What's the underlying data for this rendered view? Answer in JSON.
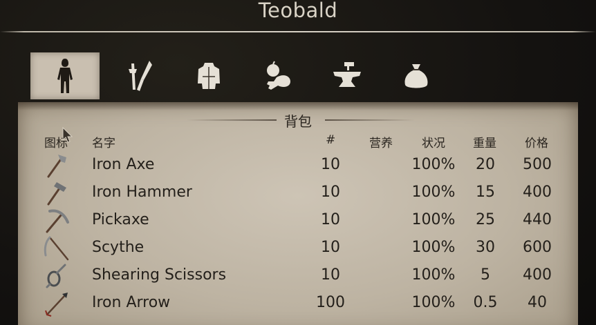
{
  "character_name": "Teobald",
  "tabs": [
    {
      "icon": "character-icon",
      "active": true
    },
    {
      "icon": "tools-icon",
      "active": false
    },
    {
      "icon": "clothing-icon",
      "active": false
    },
    {
      "icon": "food-icon",
      "active": false
    },
    {
      "icon": "anvil-icon",
      "active": false
    },
    {
      "icon": "sack-icon",
      "active": false
    }
  ],
  "section_title": "背包",
  "columns": {
    "icon": "图标",
    "name": "名字",
    "count": "#",
    "nutrition": "营养",
    "condition": "状况",
    "weight": "重量",
    "price": "价格"
  },
  "items": [
    {
      "icon": "axe-icon",
      "name": "Iron Axe",
      "count": "10",
      "nutrition": "",
      "condition": "100%",
      "weight": "20",
      "price": "500"
    },
    {
      "icon": "hammer-icon",
      "name": "Iron Hammer",
      "count": "10",
      "nutrition": "",
      "condition": "100%",
      "weight": "15",
      "price": "400"
    },
    {
      "icon": "pickaxe-icon",
      "name": "Pickaxe",
      "count": "10",
      "nutrition": "",
      "condition": "100%",
      "weight": "25",
      "price": "440"
    },
    {
      "icon": "scythe-icon",
      "name": "Scythe",
      "count": "10",
      "nutrition": "",
      "condition": "100%",
      "weight": "30",
      "price": "600"
    },
    {
      "icon": "scissors-icon",
      "name": "Shearing Scissors",
      "count": "10",
      "nutrition": "",
      "condition": "100%",
      "weight": "5",
      "price": "400"
    },
    {
      "icon": "arrow-icon",
      "name": "Iron Arrow",
      "count": "100",
      "nutrition": "",
      "condition": "100%",
      "weight": "0.5",
      "price": "40"
    }
  ],
  "colors": {
    "background": "#151311",
    "parchment": "#c2b8a7",
    "text_dark": "#231f1a",
    "title_text": "#d9d3c6",
    "active_tab": "#c9bfb0"
  }
}
